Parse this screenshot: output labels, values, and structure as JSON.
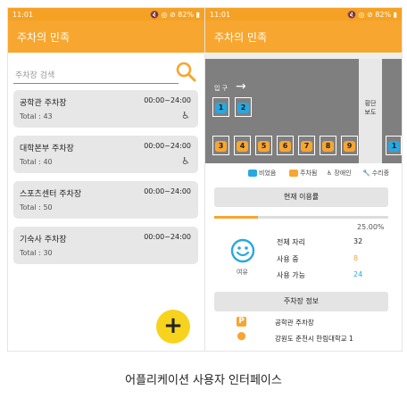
{
  "status": {
    "time": "11:01",
    "icons": "🔇 ◎ ⊘ 82% ▮"
  },
  "app": {
    "title": "주차의 민족"
  },
  "search": {
    "placeholder": "주차장 검색"
  },
  "lots": [
    {
      "name": "공학관 주차장",
      "hours": "00:00~24:00",
      "total": "Total : 43",
      "accessible": true
    },
    {
      "name": "대학본부 주차장",
      "hours": "00:00~24:00",
      "total": "Total : 40",
      "accessible": true
    },
    {
      "name": "스포츠센터 주차장",
      "hours": "00:00~24:00",
      "total": "Total : 50",
      "accessible": false
    },
    {
      "name": "기숙사 주차장",
      "hours": "00:00~24:00",
      "total": "Total : 30",
      "accessible": false
    }
  ],
  "fab": {
    "label": "+"
  },
  "map": {
    "entry_label": "입 구",
    "crosswalk_label": "횡단\n보도",
    "top_slots": [
      "1",
      "2"
    ],
    "bottom_slots": [
      "3",
      "4",
      "5",
      "6",
      "7",
      "8",
      "9"
    ],
    "right_slot": "1"
  },
  "legend": {
    "empty": "비었음",
    "parked": "주차됨",
    "disabled": "장애인",
    "repair": "수리중"
  },
  "usage": {
    "button": "현재 이용률",
    "percent_text": "25.00%",
    "percent_value": 0.25,
    "mood": "여유",
    "rows": [
      {
        "label": "전체 자리",
        "value": "32",
        "color": "#222222"
      },
      {
        "label": "사용 중",
        "value": "8",
        "color": "#f7a630"
      },
      {
        "label": "사용 가능",
        "value": "24",
        "color": "#29a8e0"
      }
    ]
  },
  "lot_info": {
    "button": "주차장 정보",
    "name": "공학관 주차장",
    "address": "강원도 춘천시 한림대학교 1"
  },
  "caption": "어플리케이션 사용자 인터페이스",
  "colors": {
    "accent": "#f7a630",
    "blue": "#29a8e0",
    "lot": "#7f7f7f"
  }
}
